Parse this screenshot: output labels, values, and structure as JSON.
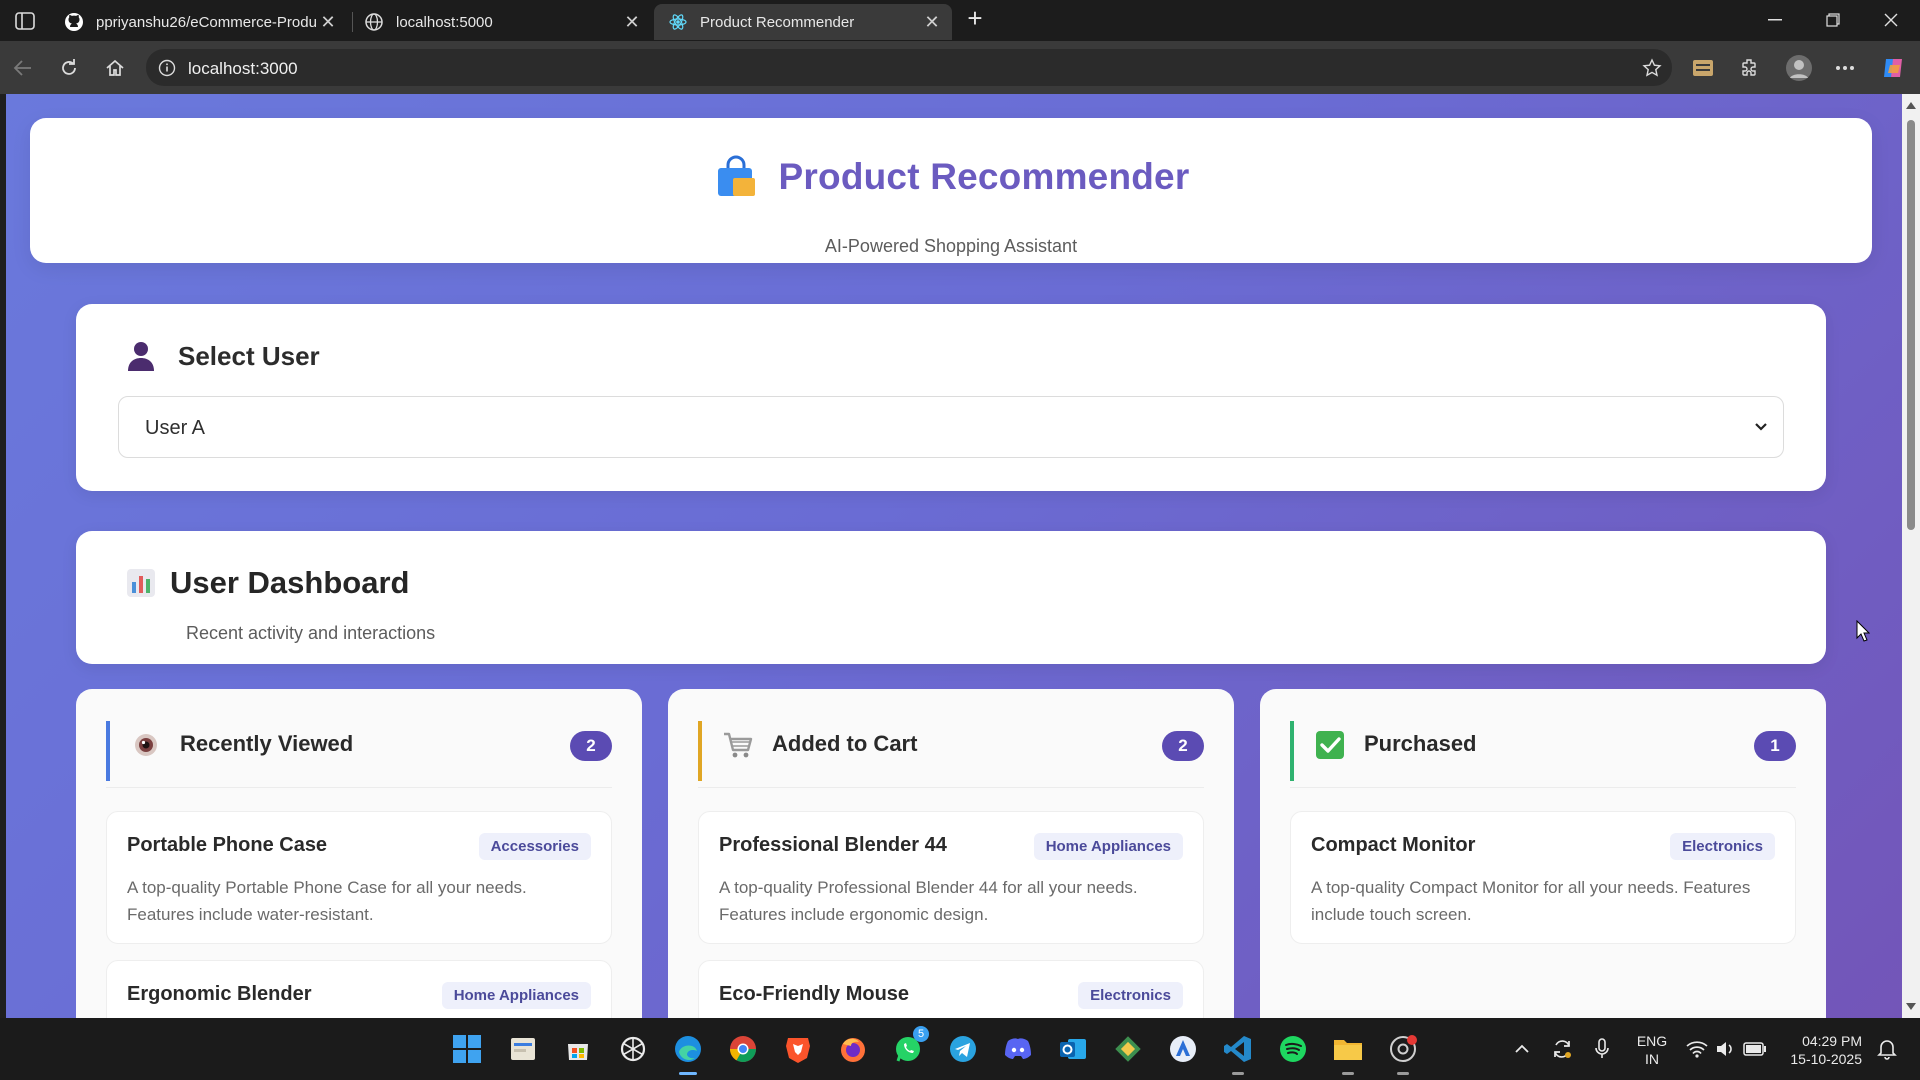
{
  "browser": {
    "tabs": [
      {
        "title": "ppriyanshu26/eCommerce-Produ",
        "icon": "github-icon"
      },
      {
        "title": "localhost:5000",
        "icon": "globe-icon"
      },
      {
        "title": "Product Recommender",
        "icon": "react-icon",
        "active": true
      }
    ],
    "url": "localhost:3000"
  },
  "page": {
    "header": {
      "title": "Product Recommender",
      "subtitle": "AI-Powered Shopping Assistant"
    },
    "select_user": {
      "label": "Select User",
      "value": "User A"
    },
    "dashboard": {
      "title": "User Dashboard",
      "subtitle": "Recent activity and interactions"
    },
    "columns": [
      {
        "title": "Recently Viewed",
        "count": "2",
        "accent": "#4a7ae0",
        "icon": "eye-icon",
        "items": [
          {
            "name": "Portable Phone Case",
            "tag": "Accessories",
            "desc": "A top-quality Portable Phone Case for all your needs. Features include water-resistant."
          },
          {
            "name": "Ergonomic Blender",
            "tag": "Home Appliances",
            "desc": ""
          }
        ]
      },
      {
        "title": "Added to Cart",
        "count": "2",
        "accent": "#e0a624",
        "icon": "cart-icon",
        "items": [
          {
            "name": "Professional Blender 44",
            "tag": "Home Appliances",
            "desc": "A top-quality Professional Blender 44 for all your needs. Features include ergonomic design."
          },
          {
            "name": "Eco-Friendly Mouse",
            "tag": "Electronics",
            "desc": ""
          }
        ]
      },
      {
        "title": "Purchased",
        "count": "1",
        "accent": "#2fb26f",
        "icon": "check-icon",
        "items": [
          {
            "name": "Compact Monitor",
            "tag": "Electronics",
            "desc": "A top-quality Compact Monitor for all your needs. Features include touch screen."
          }
        ]
      }
    ]
  },
  "taskbar": {
    "lang_line1": "ENG",
    "lang_line2": "IN",
    "time": "04:29 PM",
    "date": "15-10-2025",
    "whatsapp_badge": "5"
  }
}
